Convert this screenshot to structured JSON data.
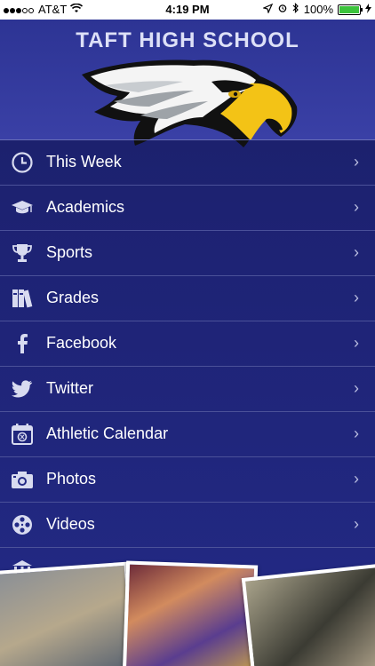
{
  "status_bar": {
    "carrier": "AT&T",
    "time": "4:19 PM",
    "battery": "100%"
  },
  "header": {
    "title": "TAFT HIGH SCHOOL"
  },
  "menu": {
    "items": [
      {
        "label": "This Week",
        "icon": "clock-icon"
      },
      {
        "label": "Academics",
        "icon": "graduation-cap-icon"
      },
      {
        "label": "Sports",
        "icon": "trophy-icon"
      },
      {
        "label": "Grades",
        "icon": "books-icon"
      },
      {
        "label": "Facebook",
        "icon": "facebook-icon"
      },
      {
        "label": "Twitter",
        "icon": "twitter-icon"
      },
      {
        "label": "Athletic Calendar",
        "icon": "calendar-icon"
      },
      {
        "label": "Photos",
        "icon": "camera-icon"
      },
      {
        "label": "Videos",
        "icon": "film-reel-icon"
      }
    ]
  },
  "colors": {
    "background": "#1e2375",
    "header": "#3a40a6",
    "divider": "#4b5199",
    "logo_yellow": "#f3c316"
  }
}
